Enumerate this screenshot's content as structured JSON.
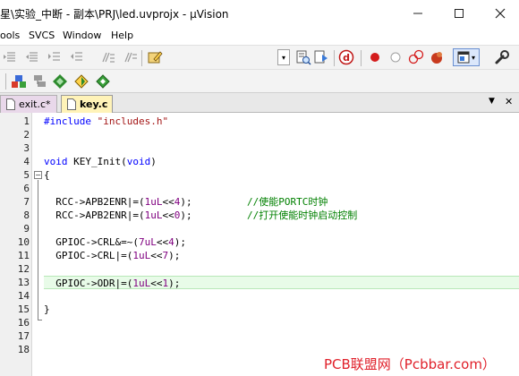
{
  "window": {
    "title": "星\\实验_中断 - 副本\\PRJ\\led.uvprojx - µVision",
    "min_glyph": "—",
    "max_glyph": "☐",
    "close_glyph": "✕"
  },
  "menu": {
    "items": [
      "ools",
      "SVCS",
      "Window",
      "Help"
    ]
  },
  "toolbar": {
    "target_select_arrow": "▾",
    "dropdown_arrow": "▾"
  },
  "tabs": [
    {
      "label": "exit.c*",
      "active": false
    },
    {
      "label": "key.c",
      "active": true
    }
  ],
  "tabbar": {
    "list_arrow": "▼",
    "close": "✕"
  },
  "editor": {
    "line_numbers": [
      "1",
      "2",
      "3",
      "4",
      "5",
      "6",
      "7",
      "8",
      "9",
      "10",
      "11",
      "12",
      "13",
      "14",
      "15",
      "16",
      "17",
      "18"
    ],
    "current_line": 13,
    "fold_open": "−",
    "code": {
      "l1_directive": "#include",
      "l1_string": "\"includes.h\"",
      "l4_void": "void",
      "l4_name": " KEY_Init(",
      "l4_void2": "void",
      "l4_close": ")",
      "l5": "{",
      "l7_code": "  RCC->APB2ENR|=(",
      "l7_num": "1uL",
      "l7_op": "<<",
      "l7_num2": "4",
      "l7_end": ");",
      "l7_comment": "//使能PORTC时钟",
      "l8_code": "  RCC->APB2ENR|=(",
      "l8_num": "1uL",
      "l8_op": "<<",
      "l8_num2": "0",
      "l8_end": ");",
      "l8_comment": "//打开使能时钟启动控制",
      "l10_code": "  GPIOC->CRL&=~(",
      "l10_num": "7uL",
      "l10_op": "<<",
      "l10_num2": "4",
      "l10_end": ");",
      "l11_code": "  GPIOC->CRL|=(",
      "l11_num": "1uL",
      "l11_op": "<<",
      "l11_num2": "7",
      "l11_end": ");",
      "l13_code": "  GPIOC->ODR|=(",
      "l13_num": "1uL",
      "l13_op": "<<",
      "l13_num2": "1",
      "l13_end": ");",
      "l15": "}"
    }
  },
  "watermark": "PCB联盟网（Pcbbar.com）",
  "colors": {
    "keyword": "#0000ff",
    "string": "#a31515",
    "number": "#800080",
    "comment": "#008000",
    "active_tab": "#fff3b8",
    "inactive_tab": "#e9d8ea",
    "current_line": "#e8fbe8",
    "watermark": "#e0202a"
  }
}
